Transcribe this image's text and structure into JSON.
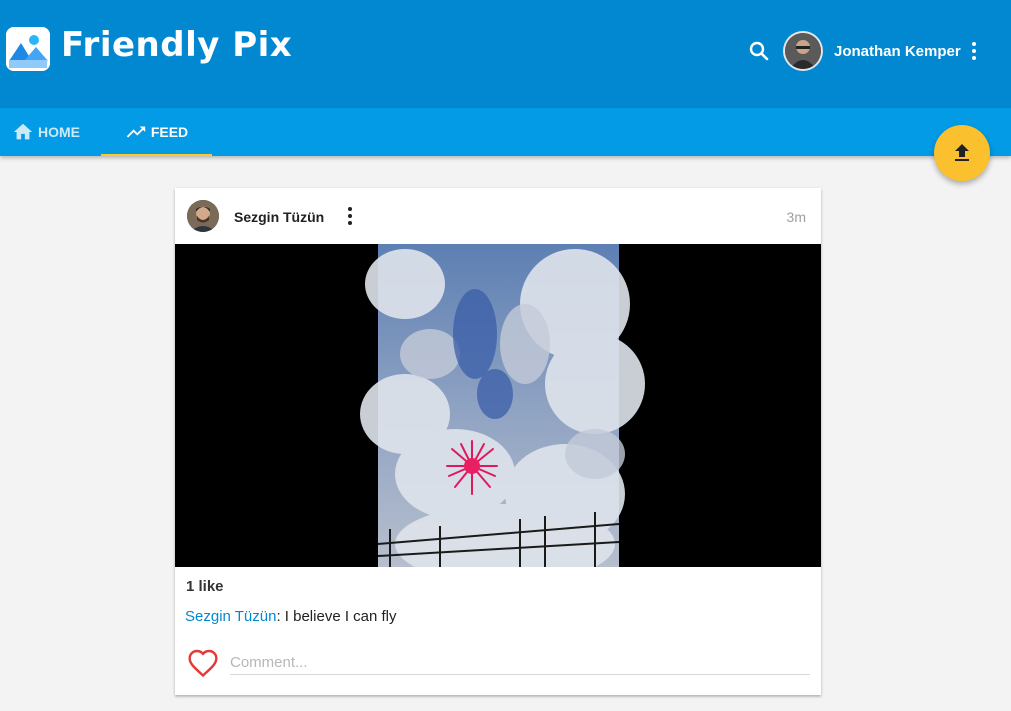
{
  "app": {
    "title": "Friendly Pix"
  },
  "header": {
    "user_name": "Jonathan Kemper"
  },
  "tabs": [
    {
      "label": "HOME",
      "icon": "home-icon"
    },
    {
      "label": "FEED",
      "icon": "trending-up-icon",
      "active": true
    }
  ],
  "fab": {
    "icon": "upload-icon"
  },
  "post": {
    "author": "Sezgin Tüzün",
    "time": "3m",
    "likes": "1 like",
    "caption_author": "Sezgin Tüzün",
    "caption_text": ": I believe I can fly",
    "comment_placeholder": "Comment..."
  },
  "colors": {
    "header": "#0288d1",
    "tabs": "#039be5",
    "accent": "#ffca28",
    "fab": "#fbc02d",
    "link": "#0288d1",
    "heart": "#e53935"
  }
}
